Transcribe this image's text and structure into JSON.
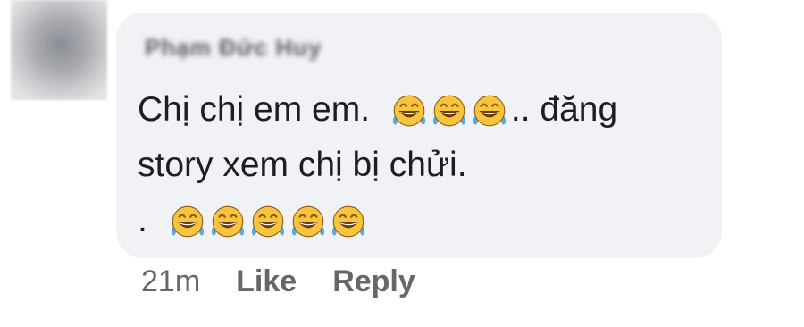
{
  "comment": {
    "author_name": "Phạm Đức Huy",
    "lines": [
      {
        "before": "Chị chị em em. ",
        "emoji_count": 3,
        "after": ".. đăng"
      },
      {
        "before": "story xem chị bị chửi.",
        "emoji_count": 0,
        "after": ""
      },
      {
        "before": ".",
        "emoji_count": 5,
        "after": ""
      }
    ],
    "emoji_icon": "face-with-tears-of-joy-icon",
    "emoji_colors": {
      "face": "#f6c43d",
      "tears": "#5aa8e6",
      "outline": "#8a5a12"
    }
  },
  "meta": {
    "timestamp": "21m",
    "like_label": "Like",
    "reply_label": "Reply"
  }
}
